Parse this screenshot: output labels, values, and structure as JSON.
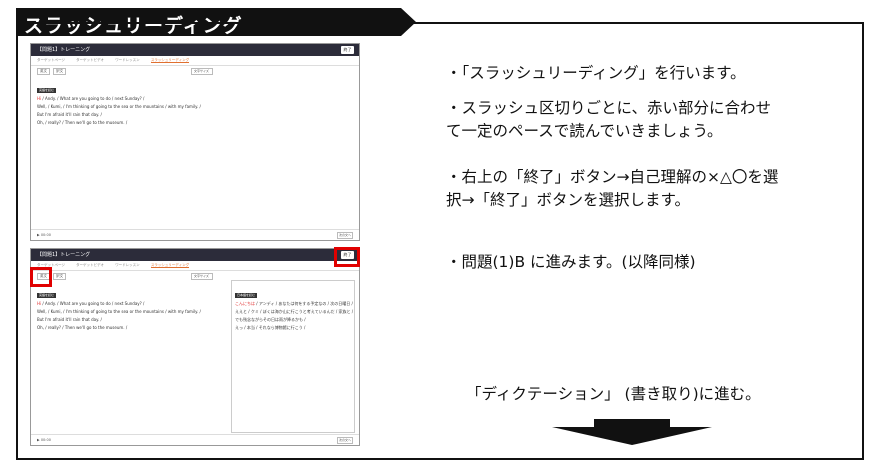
{
  "title": "スラッシュリーディング",
  "notes": [
    "・「スラッシュリーディング」を行います。",
    "・スラッシュ区切りごとに、赤い部分に合わせ",
    "て一定のペースで読んでいきましょう。",
    "・右上の「終了」ボタン→自己理解の×△〇を選",
    "択→「終了」ボタンを選択します。",
    "・問題(1)B に進みます。(以降同様)"
  ],
  "next_step": "「ディクテーション」 (書き取り)に進む。",
  "screen": {
    "header": "【問題1】トレーニング",
    "end_button": "終了",
    "tabs": [
      "ターゲットページ",
      "ターゲットビデオ",
      "ワードレッスン",
      "スラッシュリーディング"
    ],
    "toolbar_pills": [
      "英文",
      "訳文"
    ],
    "select_label": "文字サイズ",
    "badge": "英語を読む",
    "lines": [
      {
        "hl": "Hi",
        "rest": " / Andy. / What are you going to do / next Sunday? /"
      },
      {
        "hl": "",
        "rest": "Well, / Kumi, / I'm thinking of going to the sea or the mountains / with my family. /"
      },
      {
        "hl": "",
        "rest": "But I'm afraid it'll rain that day. /"
      },
      {
        "hl": "",
        "rest": "Oh, / really? / Then we'll go to the museum. /"
      }
    ],
    "jp_lines": [
      {
        "hl": "こんにちは",
        "rest": " / アンディ / あなたは何をする予定なの / 次の日曜日 /"
      },
      {
        "hl": "",
        "rest": "ええと / クミ / ぼくは海か山に行こうと考えているんだ / 家族と /"
      },
      {
        "hl": "",
        "rest": "でも残念ながらその日は雨が降るかも /"
      },
      {
        "hl": "",
        "rest": "えっ / 本当 / それなら博物館に行こう /"
      }
    ],
    "jp_badge": "日本語を読む",
    "time": "00:00",
    "nav_label": "次の文へ"
  }
}
